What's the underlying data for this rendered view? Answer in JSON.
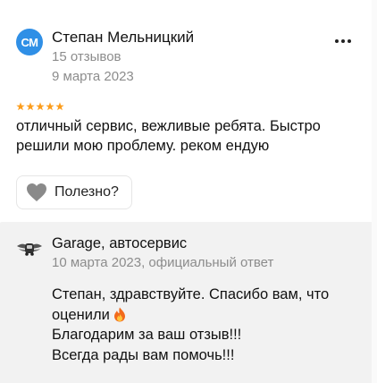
{
  "review": {
    "avatar_initials": "СМ",
    "avatar_color": "#2f8fe6",
    "author_name": "Степан Мельницкий",
    "author_reviews": "15 отзывов",
    "date": "9 марта 2023",
    "rating": 5,
    "star_color": "#fc9d1c",
    "text": "отличный сервис, вежливые ребята. Быстро решили мою проблему. реком ендую",
    "more_icon": "more-dots-icon",
    "helpful_label": "Полезно?",
    "helpful_icon": "heart-icon"
  },
  "reply": {
    "business_name": "Garage, автосервис",
    "meta": "10 марта 2023, официальный ответ",
    "logo_icon": "winged-car-logo-icon",
    "lines": [
      "Степан, здравствуйте. Спасибо вам, что",
      "оценили",
      "Благодарим за ваш отзыв!!!",
      "Всегда рады вам помочь!!!"
    ],
    "emoji_icon": "fire-icon"
  }
}
